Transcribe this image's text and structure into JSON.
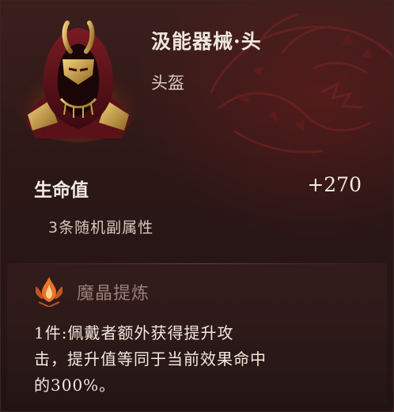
{
  "item": {
    "name": "汲能器械·头",
    "type": "头盔",
    "icon": "crimson-hooded-golden-helm-icon"
  },
  "stats": {
    "primary_name": "生命值",
    "primary_value": "+270",
    "random_affixes": "3条随机副属性"
  },
  "set_bonus": {
    "title": "魔晶提炼",
    "icon": "flame-crest-icon",
    "lines": [
      "1件:佩戴者额外获得提升攻",
      "击，提升值等同于当前效果命中",
      "的300%。"
    ]
  },
  "colors": {
    "background": "#2a1716",
    "accent_red": "#6e1c1c",
    "gold": "#c9a24a",
    "set_title": "#9a7e78",
    "flame_orange": "#e8742a"
  }
}
